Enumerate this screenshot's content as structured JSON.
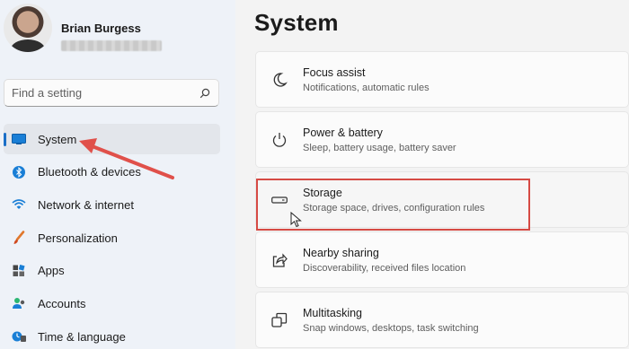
{
  "profile": {
    "name": "Brian Burgess"
  },
  "search": {
    "placeholder": "Find a setting"
  },
  "sidebar": {
    "items": [
      {
        "label": "System",
        "icon": "system-icon"
      },
      {
        "label": "Bluetooth & devices",
        "icon": "bluetooth-icon"
      },
      {
        "label": "Network & internet",
        "icon": "wifi-icon"
      },
      {
        "label": "Personalization",
        "icon": "brush-icon"
      },
      {
        "label": "Apps",
        "icon": "apps-icon"
      },
      {
        "label": "Accounts",
        "icon": "accounts-icon"
      },
      {
        "label": "Time & language",
        "icon": "time-language-icon"
      }
    ],
    "selected_index": 0
  },
  "main": {
    "title": "System",
    "cards": [
      {
        "title": "Focus assist",
        "subtitle": "Notifications, automatic rules",
        "icon": "moon-icon"
      },
      {
        "title": "Power & battery",
        "subtitle": "Sleep, battery usage, battery saver",
        "icon": "power-icon"
      },
      {
        "title": "Storage",
        "subtitle": "Storage space, drives, configuration rules",
        "icon": "storage-drive-icon"
      },
      {
        "title": "Nearby sharing",
        "subtitle": "Discoverability, received files location",
        "icon": "share-icon"
      },
      {
        "title": "Multitasking",
        "subtitle": "Snap windows, desktops, task switching",
        "icon": "multitasking-icon"
      }
    ]
  },
  "colors": {
    "accent": "#1a6fc7",
    "annotation": "#d64a44",
    "sidebar_bg": "#eef2f8",
    "main_bg": "#f3f3f3"
  }
}
